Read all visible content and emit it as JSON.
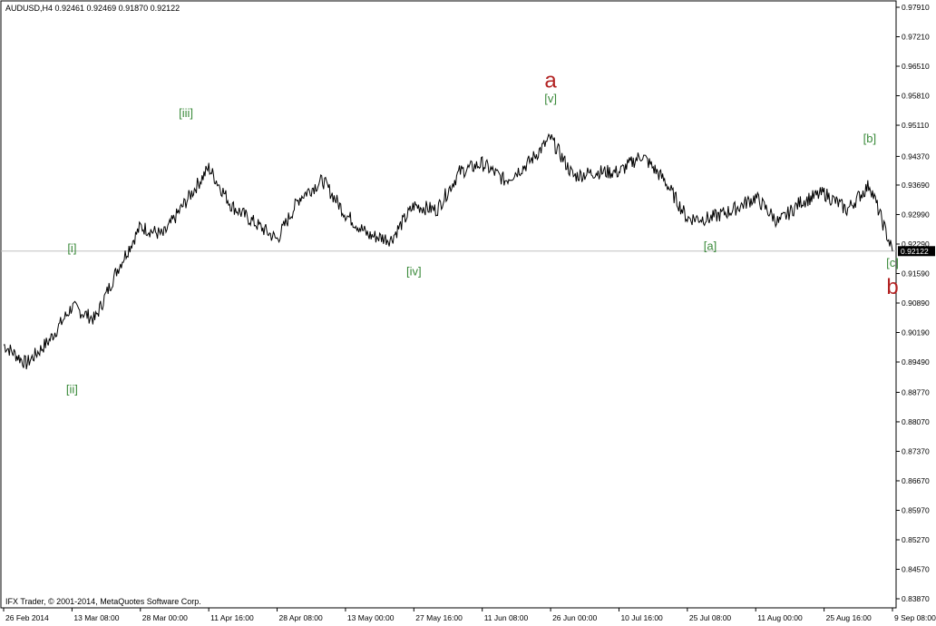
{
  "header": {
    "symbol_line": "AUDUSD,H4  0.92461 0.92469 0.91870 0.92122"
  },
  "footer": {
    "copyright": "IFX Trader, © 2001-2014, MetaQuotes Software Corp."
  },
  "colors": {
    "price_line": "#000000",
    "grid_border": "#000000",
    "wave_blue": "#1a1aff",
    "wave_red": "#b22222",
    "wave_green": "#3a8a3a",
    "wave_big_red": "#b22222",
    "current_price_line": "#c0c0c0"
  },
  "chart_data": {
    "type": "line",
    "title": "AUDUSD,H4",
    "ohlc_header": {
      "open": 0.92461,
      "high": 0.92469,
      "low": 0.9187,
      "close": 0.92122
    },
    "current_price_label": "0.92122",
    "y_ticks": [
      "0.97910",
      "0.97210",
      "0.96510",
      "0.95810",
      "0.95110",
      "0.94370",
      "0.93690",
      "0.92990",
      "0.92290",
      "0.91590",
      "0.90890",
      "0.90190",
      "0.89490",
      "0.88770",
      "0.88070",
      "0.87370",
      "0.86670",
      "0.85970",
      "0.85270",
      "0.84570",
      "0.83870"
    ],
    "ylim": [
      0.8387,
      0.9791
    ],
    "x_ticks": [
      "26 Feb 2014",
      "13 Mar 08:00",
      "28 Mar 00:00",
      "11 Apr 16:00",
      "28 Apr 08:00",
      "13 May 00:00",
      "27 May 16:00",
      "11 Jun 08:00",
      "26 Jun 00:00",
      "10 Jul 16:00",
      "25 Jul 08:00",
      "11 Aug 00:00",
      "25 Aug 16:00",
      "9 Sep 08:00"
    ],
    "x": [
      "26 Feb 2014",
      "3 Mar",
      "8 Mar",
      "13 Mar 08:00",
      "18 Mar",
      "23 Mar",
      "28 Mar 00:00",
      "2 Apr",
      "7 Apr",
      "11 Apr 16:00",
      "16 Apr",
      "22 Apr",
      "28 Apr 08:00",
      "3 May",
      "8 May",
      "13 May 00:00",
      "18 May",
      "22 May",
      "27 May 16:00",
      "1 Jun",
      "6 Jun",
      "11 Jun 08:00",
      "16 Jun",
      "21 Jun",
      "26 Jun 00:00",
      "1 Jul",
      "5 Jul",
      "10 Jul 16:00",
      "15 Jul",
      "20 Jul",
      "25 Jul 08:00",
      "30 Jul",
      "5 Aug",
      "11 Aug 00:00",
      "16 Aug",
      "20 Aug",
      "25 Aug 16:00",
      "30 Aug",
      "4 Sep",
      "9 Sep 08:00"
    ],
    "series": [
      {
        "values": [
          0.899,
          0.8945,
          0.9,
          0.908,
          0.905,
          0.917,
          0.927,
          0.925,
          0.933,
          0.941,
          0.932,
          0.928,
          0.924,
          0.934,
          0.938,
          0.93,
          0.925,
          0.924,
          0.932,
          0.931,
          0.94,
          0.942,
          0.938,
          0.942,
          0.948,
          0.939,
          0.94,
          0.94,
          0.944,
          0.938,
          0.929,
          0.929,
          0.931,
          0.934,
          0.928,
          0.933,
          0.935,
          0.931,
          0.937,
          0.9212
        ]
      }
    ],
    "wave_labels": [
      {
        "text": "[i]",
        "color": "green",
        "x": "13 Mar 08:00",
        "y": 0.921
      },
      {
        "text": "[ii]",
        "color": "green",
        "x": "13 Mar 08:00",
        "y": 0.8875
      },
      {
        "text": "[iii]",
        "color": "green",
        "x": "7 Apr",
        "y": 0.953
      },
      {
        "text": "[iv]",
        "color": "green",
        "x": "27 May 16:00",
        "y": 0.9155
      },
      {
        "text": "[v]",
        "color": "green",
        "x": "26 Jun 00:00",
        "y": 0.9565
      },
      {
        "text": "[a]",
        "color": "green",
        "x": "30 Jul",
        "y": 0.9215
      },
      {
        "text": "[b]",
        "color": "green",
        "x": "4 Sep",
        "y": 0.947
      },
      {
        "text": "[c]",
        "color": "green",
        "x": "9 Sep 08:00",
        "y": 0.9175
      },
      {
        "text": "a",
        "color": "big-red",
        "x": "26 Jun 00:00",
        "y": 0.96
      },
      {
        "text": "b",
        "color": "big-red",
        "x": "9 Sep 08:00",
        "y": 0.911
      }
    ]
  }
}
